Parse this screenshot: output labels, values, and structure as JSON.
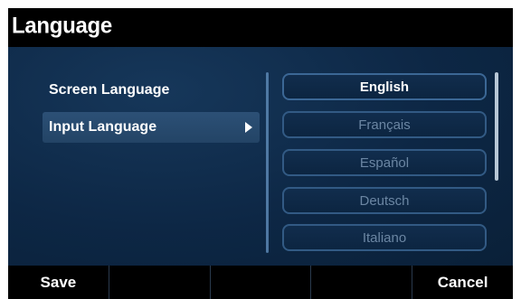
{
  "header": {
    "title": "Language"
  },
  "menu": {
    "items": [
      {
        "label": "Screen Language"
      },
      {
        "label": "Input Language"
      }
    ]
  },
  "options": [
    {
      "label": "English"
    },
    {
      "label": "Français"
    },
    {
      "label": "Español"
    },
    {
      "label": "Deutsch"
    },
    {
      "label": "Italiano"
    }
  ],
  "softkeys": [
    {
      "label": "Save"
    },
    {
      "label": ""
    },
    {
      "label": ""
    },
    {
      "label": ""
    },
    {
      "label": "Cancel"
    }
  ],
  "colors": {
    "title_bar": "#000000",
    "background": "#0d2745",
    "selected_item": "#2c5076",
    "option_border": "#325a84",
    "active_option_text": "#ffffff",
    "inactive_option_text": "#6b86a3"
  },
  "state": {
    "selected_menu_item": "Input Language",
    "active_option": "English"
  }
}
